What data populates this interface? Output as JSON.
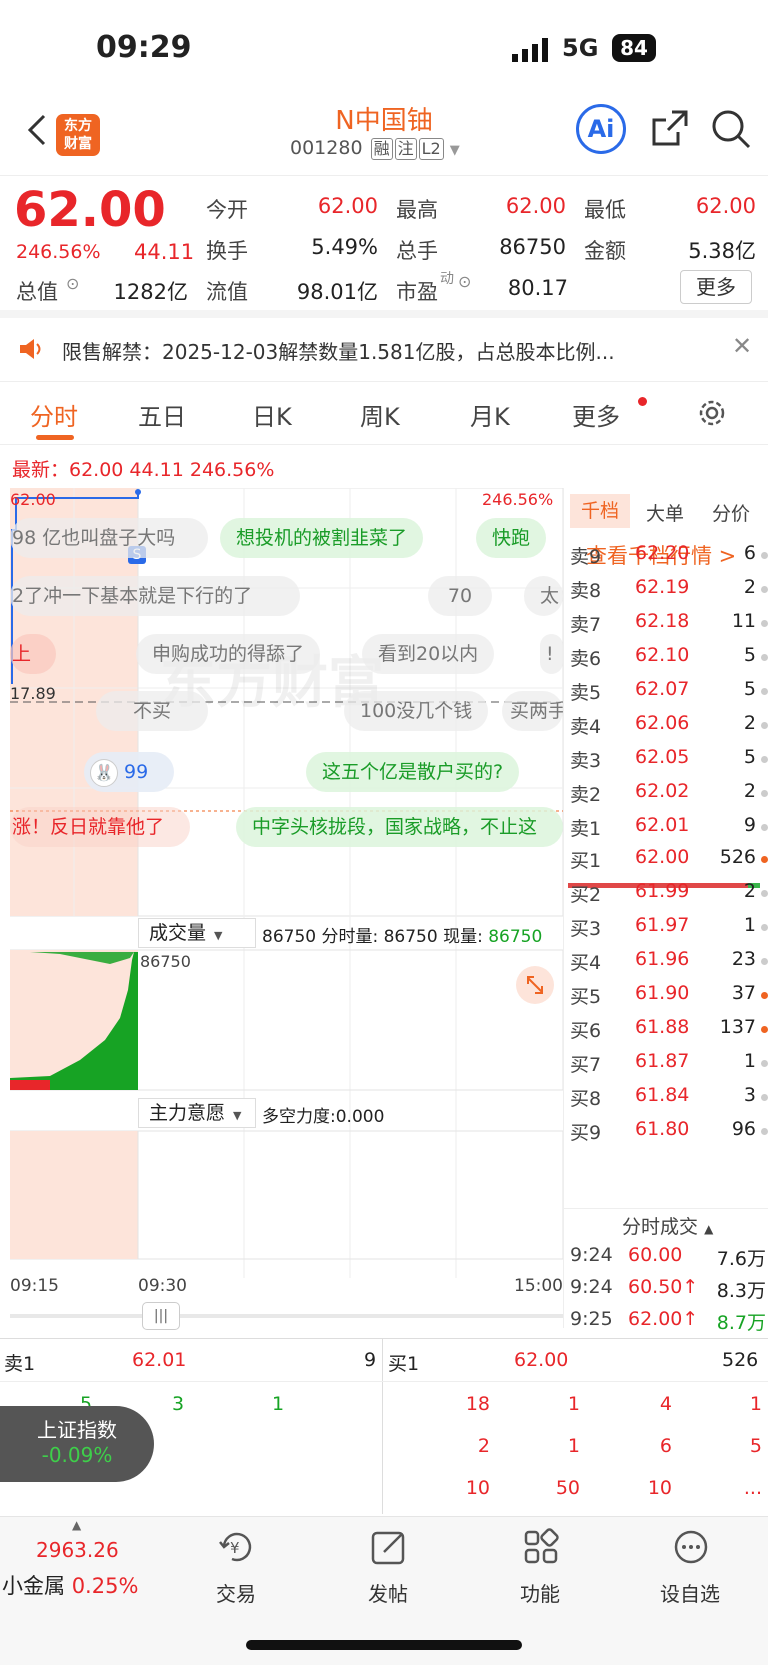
{
  "status": {
    "time": "09:29",
    "network": "5G",
    "battery": "84"
  },
  "header": {
    "title": "N中国铀",
    "code": "001280",
    "tags": [
      "融",
      "注",
      "L2"
    ]
  },
  "quote": {
    "price": "62.00",
    "pct": "246.56%",
    "chg": "44.11",
    "f": [
      {
        "k": "今开",
        "v": "62.00"
      },
      {
        "k": "最高",
        "v": "62.00"
      },
      {
        "k": "最低",
        "v": "62.00"
      },
      {
        "k": "换手",
        "v": "5.49%"
      },
      {
        "k": "总手",
        "v": "86750"
      },
      {
        "k": "金额",
        "v": "5.38亿"
      },
      {
        "k": "总值",
        "v": "1282亿"
      },
      {
        "k": "流值",
        "v": "98.01亿"
      },
      {
        "k": "市盈",
        "v": "80.17"
      }
    ],
    "sup": "动",
    "more": "更多"
  },
  "notice": {
    "text": "限售解禁：2025-12-03解禁数量1.581亿股，占总股本比例..."
  },
  "tabs": [
    "分时",
    "五日",
    "日K",
    "周K",
    "月K",
    "更多"
  ],
  "latest": "最新：62.00  44.11  246.56%",
  "chart": {
    "top_price": "62.00",
    "top_pct": "246.56%",
    "base": "17.89",
    "time_start": "09:15",
    "time_mid": "09:30",
    "time_end": "15:00",
    "vol_label": "成交量",
    "vol_info": "86750 分时量: 86750 现量:",
    "vol_now": "86750",
    "vol_max": "86750",
    "main_label": "主力意愿",
    "main_info": "多空力度:0.000",
    "badge": "S"
  },
  "comments": [
    {
      "t": "98 亿也叫盘子大吗",
      "s": "gray"
    },
    {
      "t": "想投机的被割韭菜了",
      "s": "green"
    },
    {
      "t": "快跑",
      "s": "green"
    },
    {
      "t": "2了冲一下基本就是下行的了",
      "s": "gray"
    },
    {
      "t": "70",
      "s": "gray"
    },
    {
      "t": "太",
      "s": "gray"
    },
    {
      "t": "上",
      "s": "red"
    },
    {
      "t": "申购成功的得舔了",
      "s": "gray"
    },
    {
      "t": "看到20以内",
      "s": "gray"
    },
    {
      "t": "!",
      "s": "gray"
    },
    {
      "t": "不买",
      "s": "gray"
    },
    {
      "t": "100没几个钱",
      "s": "gray"
    },
    {
      "t": "买两手",
      "s": "gray"
    },
    {
      "t": "99",
      "s": "blue"
    },
    {
      "t": "这五个亿是散户买的?",
      "s": "green"
    },
    {
      "t": "涨！反日就靠他了",
      "s": "red"
    },
    {
      "t": "中字头核拢段，国家战略，不止这",
      "s": "green"
    }
  ],
  "watermark": "东方财富",
  "book": {
    "tabs": [
      "千档",
      "大单",
      "分价"
    ],
    "link": "查看千档行情 >",
    "sell": [
      [
        "卖9",
        "62.20",
        "6"
      ],
      [
        "卖8",
        "62.19",
        "2"
      ],
      [
        "卖7",
        "62.18",
        "11"
      ],
      [
        "卖6",
        "62.10",
        "5"
      ],
      [
        "卖5",
        "62.07",
        "5"
      ],
      [
        "卖4",
        "62.06",
        "2"
      ],
      [
        "卖3",
        "62.05",
        "5"
      ],
      [
        "卖2",
        "62.02",
        "2"
      ],
      [
        "卖1",
        "62.01",
        "9"
      ]
    ],
    "buy": [
      [
        "买1",
        "62.00",
        "526"
      ],
      [
        "买2",
        "61.99",
        "2"
      ],
      [
        "买3",
        "61.97",
        "1"
      ],
      [
        "买4",
        "61.96",
        "23"
      ],
      [
        "买5",
        "61.90",
        "37"
      ],
      [
        "买6",
        "61.88",
        "137"
      ],
      [
        "买7",
        "61.87",
        "1"
      ],
      [
        "买8",
        "61.84",
        "3"
      ],
      [
        "买9",
        "61.80",
        "96"
      ]
    ],
    "trades_title": "分时成交",
    "trades": [
      [
        "9:24",
        "60.00",
        "7.6万"
      ],
      [
        "9:24",
        "60.50↑",
        "8.3万"
      ],
      [
        "9:25",
        "62.00↑",
        "8.7万"
      ]
    ]
  },
  "level": {
    "sell_label": "卖1",
    "sell_price": "62.01",
    "sell_vol": "9",
    "buy_label": "买1",
    "buy_price": "62.00",
    "buy_vol": "526",
    "left_nums": [
      "5",
      "3",
      "1"
    ],
    "right_rows": [
      [
        "18",
        "1",
        "4",
        "1"
      ],
      [
        "2",
        "1",
        "6",
        "5"
      ],
      [
        "10",
        "50",
        "10",
        "..."
      ]
    ]
  },
  "index": {
    "name": "上证指数",
    "pct": "-0.09%"
  },
  "bottom": {
    "value": "2963.26",
    "sector": "小金属",
    "sector_pct": "0.25%",
    "items": [
      "交易",
      "发帖",
      "功能",
      "设自选"
    ]
  }
}
